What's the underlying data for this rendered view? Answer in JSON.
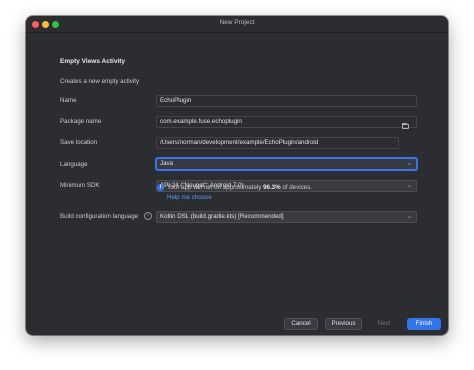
{
  "window": {
    "title": "New Project"
  },
  "page": {
    "heading": "Empty Views Activity",
    "description": "Creates a new empty activity"
  },
  "form": {
    "name": {
      "label": "Name",
      "value": "EchoPlugin"
    },
    "package_name": {
      "label": "Package name",
      "value": "com.example.fuse.echoplugin"
    },
    "save_location": {
      "label": "Save location",
      "value": "/Users/norman/development/example/EchoPlugin/android"
    },
    "language": {
      "label": "Language",
      "value": "Java"
    },
    "minimum_sdk": {
      "label": "Minimum SDK",
      "value": "API 24 (\"Nougat\"; Android 7.0)"
    },
    "build_config": {
      "label": "Build configuration language",
      "value": "Kotlin DSL (build.gradle.kts) [Recommended]"
    }
  },
  "sdk_info": {
    "text_before": "Your app will run on approximately ",
    "percentage": "96.3%",
    "text_after": " of devices.",
    "help_link": "Help me choose"
  },
  "buttons": {
    "cancel": "Cancel",
    "previous": "Previous",
    "next": "Next",
    "finish": "Finish"
  },
  "icons": {
    "info": "info-icon",
    "help": "question-icon",
    "folder": "folder-icon",
    "dropdown": "chevron-down-icon"
  },
  "colors": {
    "accent": "#3574f0",
    "link": "#589df6",
    "background": "#2b2d30"
  }
}
